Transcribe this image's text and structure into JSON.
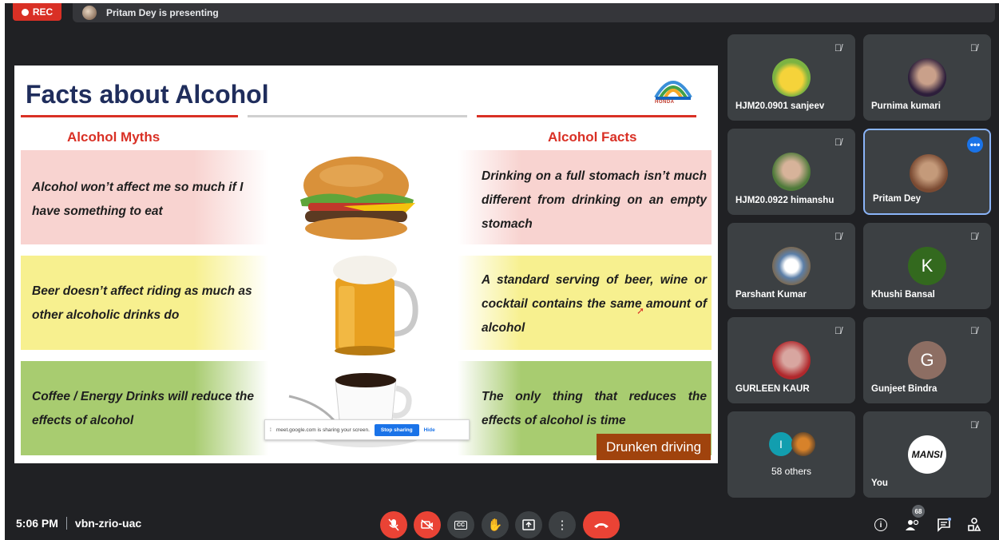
{
  "top_bar": {
    "rec_label": "REC",
    "presenting_text": "Pritam Dey is presenting"
  },
  "slide": {
    "title": "Facts about Alcohol",
    "logo_text": "HONDA",
    "myths_header": "Alcohol Myths",
    "facts_header": "Alcohol Facts",
    "rows": [
      {
        "myth": "Alcohol won’t affect me so much if I have something to eat",
        "fact": "Drinking on a full stomach isn’t much different from drinking on an empty stomach",
        "band_color": "#f8d3d0",
        "image": "burger-image"
      },
      {
        "myth": "Beer doesn’t affect riding as much as other alcoholic drinks do",
        "fact": "A standard serving of beer, wine or cocktail contains the same amount of alcohol",
        "band_color": "#f7f08f",
        "image": "beer-mug-image"
      },
      {
        "myth": "Coffee / Energy Drinks will reduce the effects of alcohol",
        "fact": "The only thing that reduces the effects of alcohol is time",
        "band_color": "#a8cc70",
        "image": "coffee-cup-image"
      }
    ],
    "footer_label": "Drunken driving",
    "share_notice": {
      "text": "meet.google.com is sharing your screen.",
      "stop_label": "Stop sharing",
      "hide_label": "Hide"
    }
  },
  "participants": [
    {
      "name": "HJM20.0901 sanjeev",
      "avatar": "photo",
      "muted": true
    },
    {
      "name": "Purnima kumari",
      "avatar": "photo",
      "muted": true
    },
    {
      "name": "HJM20.0922 himanshu",
      "avatar": "photo",
      "muted": true
    },
    {
      "name": "Pritam Dey",
      "avatar": "photo",
      "muted": false,
      "active": true
    },
    {
      "name": "Parshant Kumar",
      "avatar": "photo",
      "muted": true
    },
    {
      "name": "Khushi Bansal",
      "avatar": "K",
      "avatar_color": "#33691e",
      "muted": true
    },
    {
      "name": "GURLEEN KAUR",
      "avatar": "photo",
      "muted": true
    },
    {
      "name": "Gunjeet Bindra",
      "avatar": "G",
      "avatar_color": "#8d6e63",
      "muted": true
    },
    {
      "name": "58 others",
      "avatar": "group",
      "others_initial": "I"
    },
    {
      "name": "You",
      "avatar": "MANSI",
      "muted": true
    }
  ],
  "bottom_bar": {
    "time": "5:06 PM",
    "meeting_code": "vbn-zrio-uac",
    "people_count": "68"
  },
  "colors": {
    "background": "#202124",
    "tile": "#3c4043",
    "accent_red": "#ea4335",
    "accent_blue": "#1a73e8"
  }
}
